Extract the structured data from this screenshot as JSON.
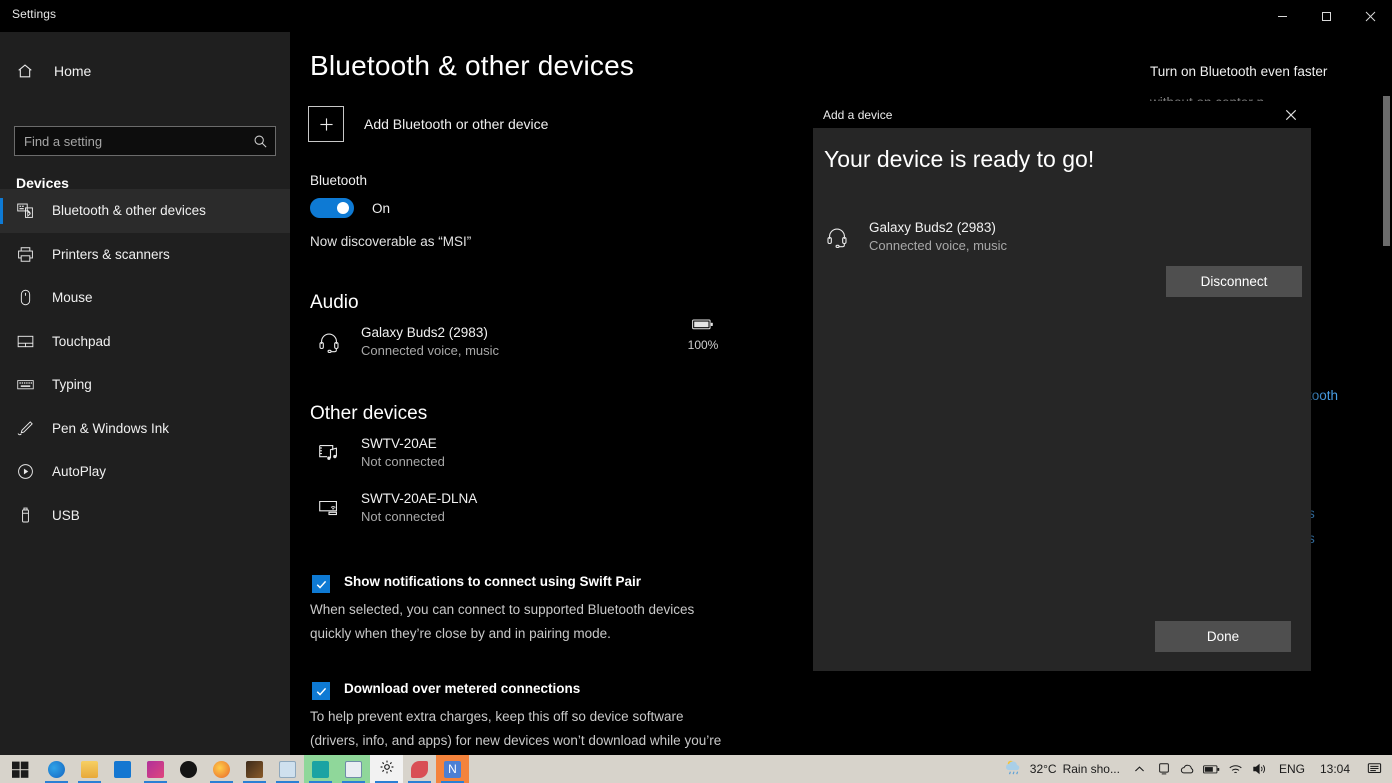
{
  "window": {
    "title": "Settings",
    "minimize_label": "Minimize",
    "maximize_label": "Maximize",
    "close_label": "Close"
  },
  "sidebar": {
    "home_label": "Home",
    "search": {
      "placeholder": "Find a setting",
      "value": ""
    },
    "section_title": "Devices",
    "items": [
      {
        "label": "Bluetooth & other devices",
        "icon": "bluetooth-devices-icon",
        "selected": true
      },
      {
        "label": "Printers & scanners",
        "icon": "printer-icon",
        "selected": false
      },
      {
        "label": "Mouse",
        "icon": "mouse-icon",
        "selected": false
      },
      {
        "label": "Touchpad",
        "icon": "touchpad-icon",
        "selected": false
      },
      {
        "label": "Typing",
        "icon": "keyboard-icon",
        "selected": false
      },
      {
        "label": "Pen & Windows Ink",
        "icon": "pen-icon",
        "selected": false
      },
      {
        "label": "AutoPlay",
        "icon": "autoplay-icon",
        "selected": false
      },
      {
        "label": "USB",
        "icon": "usb-icon",
        "selected": false
      }
    ]
  },
  "main": {
    "page_title": "Bluetooth & other devices",
    "add_device_label": "Add Bluetooth or other device",
    "bluetooth_label": "Bluetooth",
    "bluetooth_state": "On",
    "discoverable_text": "Now discoverable as “MSI”",
    "audio_group": "Audio",
    "audio_devices": [
      {
        "name": "Galaxy Buds2 (2983)",
        "status": "Connected voice, music",
        "icon": "headset-icon",
        "battery": "100%"
      }
    ],
    "other_group": "Other devices",
    "other_devices": [
      {
        "name": "SWTV-20AE",
        "status": "Not connected",
        "icon": "media-device-icon"
      },
      {
        "name": "SWTV-20AE-DLNA",
        "status": "Not connected",
        "icon": "cast-display-icon"
      }
    ],
    "checkboxes": [
      {
        "label": "Show notifications to connect using Swift Pair",
        "checked": true,
        "description": "When selected, you can connect to supported Bluetooth devices quickly when they’re close by and in pairing mode."
      },
      {
        "label": "Download over metered connections",
        "checked": true,
        "description": "To help prevent extra charges, keep this off so device software (drivers, info, and apps) for new devices won’t download while you’re on metered Internet connections."
      }
    ]
  },
  "right_panel": {
    "heading": "Turn on Bluetooth even faster",
    "description": "without on center n.",
    "link_1": "tooth",
    "link_2": "s",
    "link_3": "s"
  },
  "dialog": {
    "title": "Add a device",
    "close_label": "Close",
    "heading": "Your device is ready to go!",
    "device": {
      "name": "Galaxy Buds2 (2983)",
      "status": "Connected voice, music",
      "icon": "headset-icon"
    },
    "disconnect_label": "Disconnect",
    "done_label": "Done"
  },
  "taskbar": {
    "start_label": "Start",
    "apps": [
      {
        "name": "edge",
        "color": "#2b8ed6",
        "active": true
      },
      {
        "name": "file-explorer",
        "color": "#f7c54b",
        "active": true
      },
      {
        "name": "mail",
        "color": "#0f7ad4",
        "active": false
      },
      {
        "name": "photo-app",
        "color": "#c9318d",
        "active": true
      },
      {
        "name": "xbox",
        "color": "#1b1b1b",
        "active": false
      },
      {
        "name": "firefox",
        "color": "#f2a33c",
        "active": true
      },
      {
        "name": "dark-app",
        "color": "#3a2a1c",
        "active": true
      },
      {
        "name": "paint",
        "color": "#9fc6e8",
        "active": true
      },
      {
        "name": "teams",
        "color": "#5fc97a",
        "active": true
      },
      {
        "name": "store-app",
        "color": "#4c7fc0",
        "active": true
      },
      {
        "name": "settings",
        "color": "#f2f2f2",
        "active": true
      },
      {
        "name": "snip-tool",
        "color": "#d94f55",
        "active": true
      },
      {
        "name": "notion-app",
        "color": "#f06a2a",
        "active": true
      }
    ],
    "weather_temp": "32°C",
    "weather_desc": "Rain sho...",
    "tray_icons": [
      "chevron-up-icon",
      "onedrive-sync-icon",
      "cloud-icon",
      "battery-icon",
      "wifi-icon",
      "volume-icon"
    ],
    "language": "ENG",
    "clock": "13:04",
    "action_center_label": "Action Center"
  }
}
